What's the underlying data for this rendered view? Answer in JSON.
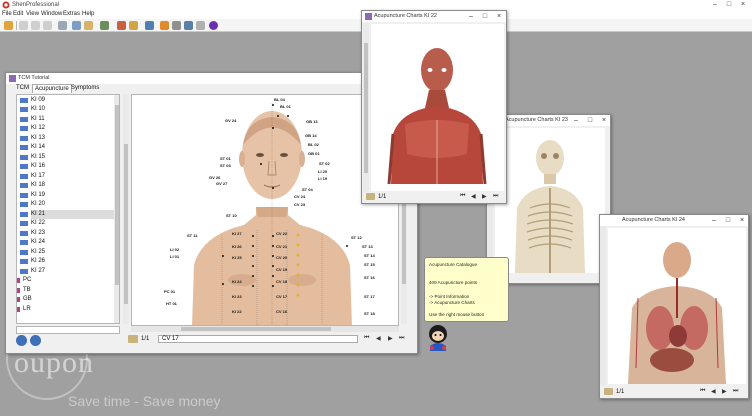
{
  "app": {
    "title": "ShenProfessional",
    "menu": [
      "File",
      "Edit",
      "View",
      "Window",
      "Extras",
      "Help"
    ]
  },
  "tcm_window": {
    "title": "TCM Tutorial",
    "tabs": [
      "TCM",
      "Acupuncture",
      "Symptoms"
    ],
    "tree_items": [
      "KI 09",
      "KI 10",
      "KI 11",
      "KI 12",
      "KI 13",
      "KI 14",
      "KI 15",
      "KI 16",
      "KI 17",
      "KI 18",
      "KI 19",
      "KI 20",
      "KI 21",
      "KI 22",
      "KI 23",
      "KI 24",
      "KI 25",
      "KI 26",
      "KI 27"
    ],
    "selected_item": "KI 21",
    "meridian_items": [
      "PC",
      "TB",
      "GB",
      "LR"
    ],
    "page": "1/1",
    "point_field": "CV 17",
    "point_labels": {
      "bl04": "BL 04",
      "bl01": "BL 01",
      "gv24": "GV 24",
      "gb13": "GB 13",
      "gb14": "GB 14",
      "bl02": "BL 02",
      "gb01": "GB 01",
      "st01": "ST 01",
      "st02": "ST 02",
      "st03": "ST 03",
      "li20": "LI 20",
      "li19": "LI 19",
      "gv26": "GV 26",
      "gv27": "GV 27",
      "st04": "ST 04",
      "cv24": "CV 24",
      "cv23": "CV 23",
      "li02": "LI 02",
      "li01": "LI 01",
      "st10": "ST 10",
      "st11": "ST 11",
      "st12": "ST 12",
      "st13": "ST 13",
      "st14": "ST 14",
      "st15": "ST 15",
      "st16": "ST 16",
      "st17": "ST 17",
      "st18": "ST 18",
      "cv22": "CV 22",
      "cv21": "CV 21",
      "cv20": "CV 20",
      "cv19": "CV 19",
      "cv18": "CV 18",
      "cv17": "CV 17",
      "cv16": "CV 16",
      "ki27": "KI 27",
      "ki26": "KI 26",
      "ki25": "KI 25",
      "ki24": "KI 24",
      "ki23": "KI 23",
      "ki22": "KI 22",
      "pc01": "PC 01",
      "ht01": "HT 01"
    }
  },
  "chart_windows": [
    {
      "title": "Acupuncture Charts KI 22",
      "page": "1/1"
    },
    {
      "title": "Acupuncture Charts KI 23"
    },
    {
      "title": "Acupuncture Charts KI 24",
      "page": "1/1"
    }
  ],
  "tooltip": {
    "line1": "Acupuncture Catalogue",
    "line2": "409 Acupuncture points",
    "line3": "-> Point Information",
    "line4": "-> Acupuncture Charts",
    "line5": "Use the right mouse button"
  },
  "watermark": {
    "brand": "oupon",
    "tagline": "Save time - Save money"
  },
  "colors": {
    "skin": "#e6c2a6",
    "muscle": "#b8473b",
    "bone": "#e8dcc4",
    "tooltip": "#ffffcc",
    "accent": "#6a2fb0"
  }
}
